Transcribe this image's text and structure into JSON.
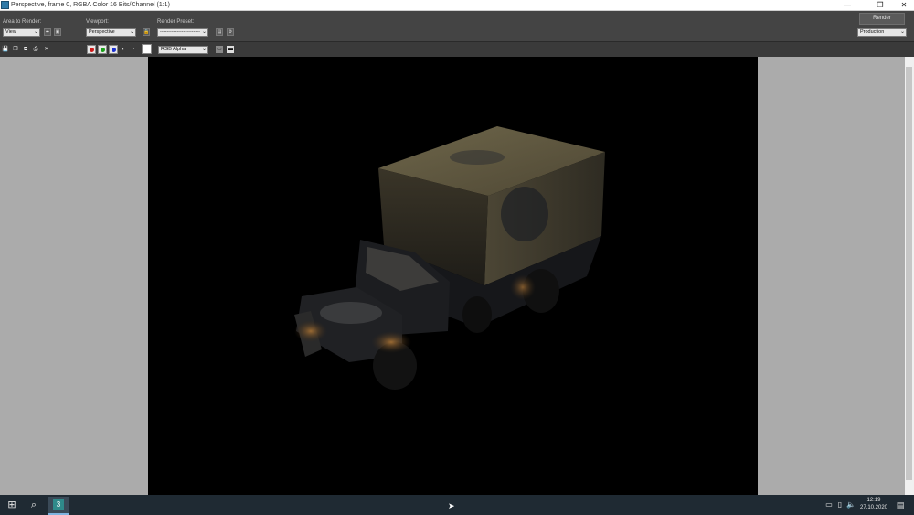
{
  "window": {
    "title": "Perspective, frame 0, RGBA Color 16 Bits/Channel (1:1)",
    "minimize": "—",
    "maximize": "❐",
    "close": "✕"
  },
  "toolbar": {
    "area_label": "Area to Render:",
    "area_value": "View",
    "viewport_label": "Viewport:",
    "viewport_value": "Perspective",
    "preset_label": "Render Preset:",
    "preset_value": "------------------------",
    "render_button": "Render",
    "production_value": "Production"
  },
  "channel_toolbar": {
    "alpha_select": "RGB Alpha"
  },
  "taskbar": {
    "time": "12:19",
    "date": "27.10.2020"
  },
  "colors": {
    "red_channel": "#d01a1a",
    "green_channel": "#18a018",
    "blue_channel": "#1a2fd0"
  }
}
